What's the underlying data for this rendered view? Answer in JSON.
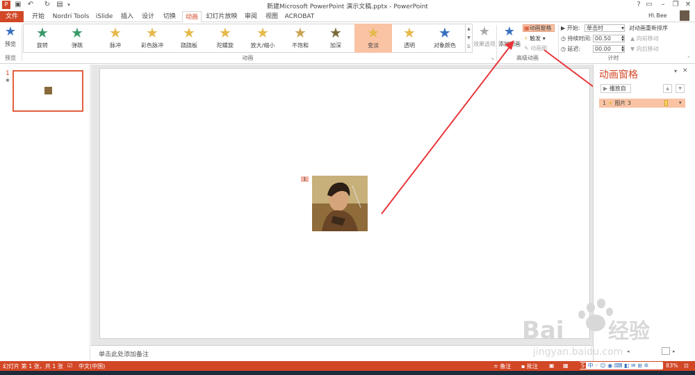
{
  "window": {
    "title": "新建Microsoft PowerPoint 演示文稿.pptx - PowerPoint",
    "help": "?",
    "user": "H\\ Bee"
  },
  "tabs": [
    {
      "label": "文件"
    },
    {
      "label": "开始"
    },
    {
      "label": "Nordri Tools"
    },
    {
      "label": "iSlide"
    },
    {
      "label": "插入"
    },
    {
      "label": "设计"
    },
    {
      "label": "切换"
    },
    {
      "label": "动画"
    },
    {
      "label": "幻灯片放映"
    },
    {
      "label": "审阅"
    },
    {
      "label": "视图"
    },
    {
      "label": "ACROBAT"
    }
  ],
  "ribbon": {
    "preview_label": "预览",
    "preview_group": "预览",
    "animations": [
      {
        "label": "旋转",
        "color": "#3a9a6a"
      },
      {
        "label": "弹跳",
        "color": "#3a9a6a"
      },
      {
        "label": "脉冲",
        "color": "#e6b94a"
      },
      {
        "label": "彩色脉冲",
        "color": "#e6b94a"
      },
      {
        "label": "跷跷板",
        "color": "#e6b94a"
      },
      {
        "label": "陀螺旋",
        "color": "#e6b94a"
      },
      {
        "label": "放大/缩小",
        "color": "#e6b94a"
      },
      {
        "label": "不饱和",
        "color": "#c9a24f"
      },
      {
        "label": "加深",
        "color": "#7a6a3a"
      },
      {
        "label": "变淡",
        "color": "#e6b94a"
      },
      {
        "label": "透明",
        "color": "#e6b94a"
      },
      {
        "label": "对象颜色",
        "color": "#3a70c0"
      }
    ],
    "animation_group": "动画",
    "effect_options": "效果选项",
    "add_animation": "添加动画",
    "animation_pane_btn": "动画窗格",
    "trigger_btn": "触发",
    "animation_painter": "动画刷",
    "advanced_group": "高级动画",
    "start_label": "开始:",
    "start_value": "单击时",
    "duration_label": "持续时间:",
    "duration_value": "00.50",
    "delay_label": "延迟:",
    "delay_value": "00.00",
    "reorder_title": "对动画重新排序",
    "move_earlier": "向前移动",
    "move_later": "向后移动",
    "timing_group": "计时"
  },
  "thumbs": {
    "number": "1",
    "star": "✱"
  },
  "slide": {
    "anim_tag": "1"
  },
  "notes": {
    "placeholder": "单击此处添加备注"
  },
  "animpane": {
    "title": "动画窗格",
    "play_button": "播放自",
    "item_number": "1",
    "item_label": "图片 3"
  },
  "status": {
    "slide_info": "幻灯片 第 1 张，共 1 张",
    "language": "中文(中国)",
    "notes_btn": "备注",
    "comments_btn": "批注",
    "zoom": "83%"
  },
  "colors": {
    "accent": "#d24726",
    "arrow": "#e8353a",
    "selected": "#f9c3a4"
  }
}
